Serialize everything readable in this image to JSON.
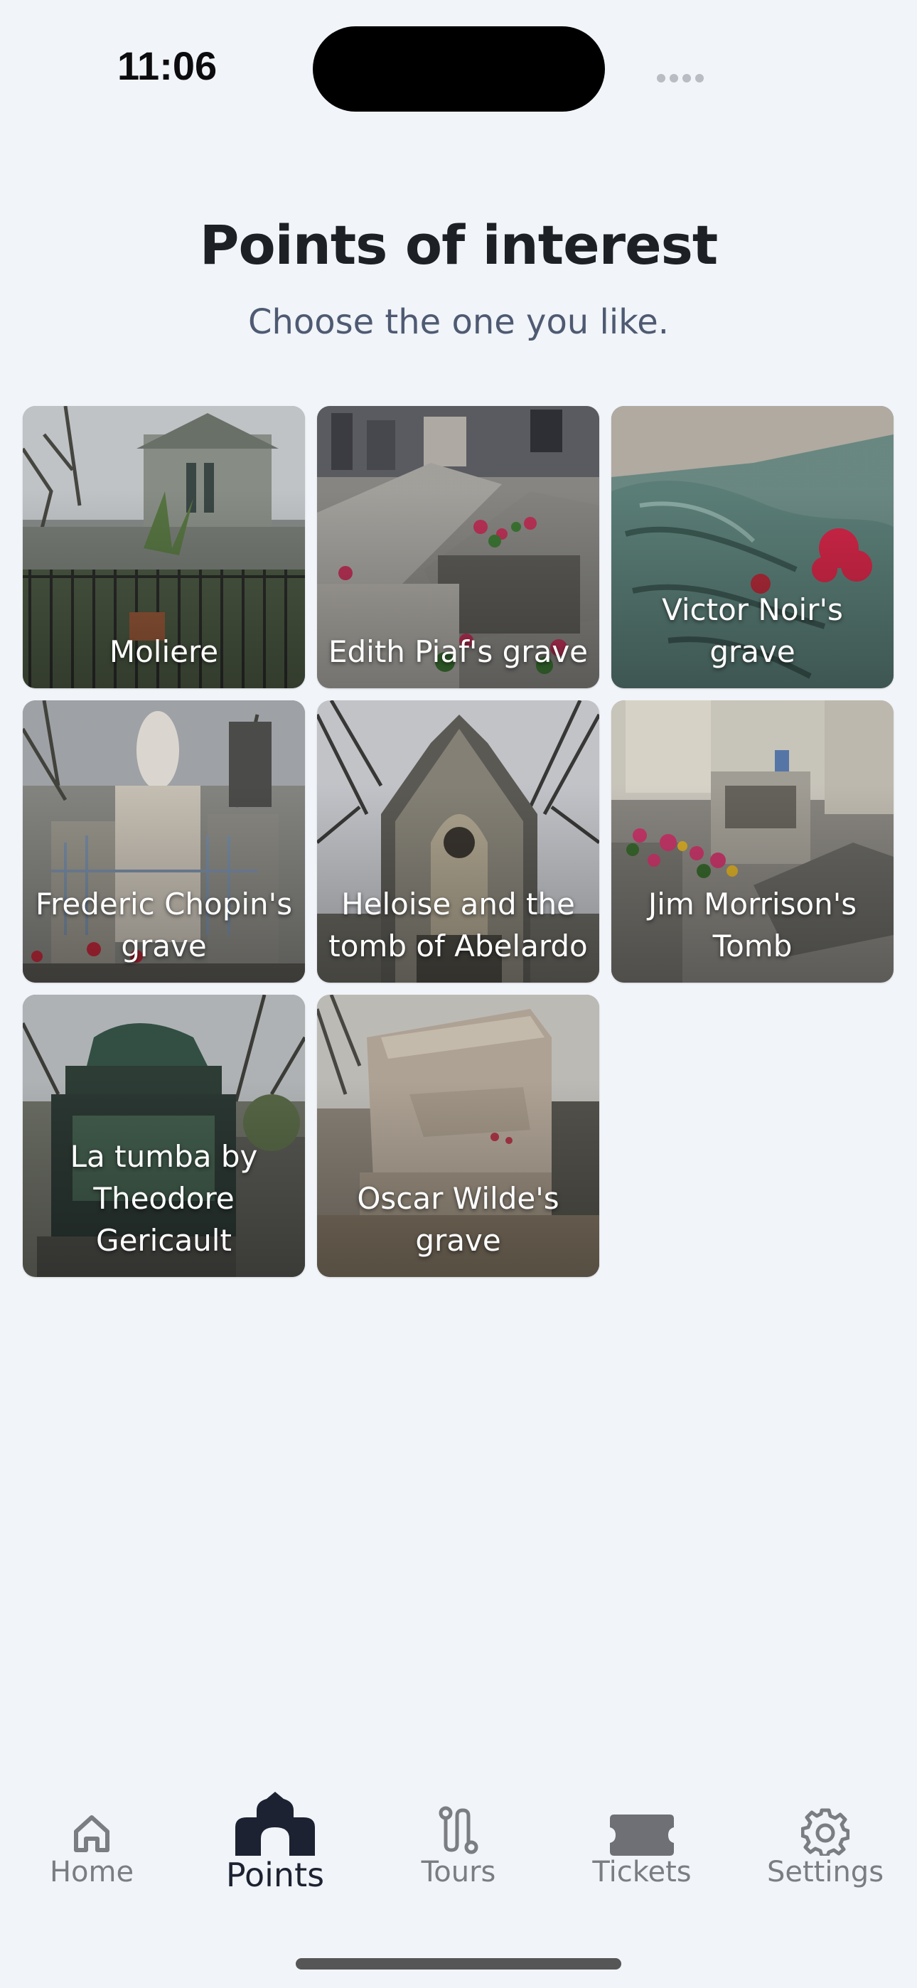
{
  "status_bar": {
    "time": "11:06"
  },
  "header": {
    "title": "Points of interest",
    "subtitle": "Choose the one you like."
  },
  "points": [
    {
      "label": "Moliere",
      "photo": "tomb-photo"
    },
    {
      "label": "Edith Piaf's grave",
      "photo": "tomb-photo"
    },
    {
      "label": "Victor Noir's grave",
      "photo": "statue-photo"
    },
    {
      "label": "Frederic Chopin's grave",
      "photo": "statue-photo"
    },
    {
      "label": "Heloise and the tomb of Abelardo",
      "photo": "chapel-photo"
    },
    {
      "label": "Jim Morrison's Tomb",
      "photo": "tomb-photo"
    },
    {
      "label": "La tumba by Theodore Gericault",
      "photo": "statue-photo"
    },
    {
      "label": "Oscar Wilde's grave",
      "photo": "monument-photo"
    }
  ],
  "tabbar": {
    "items": [
      {
        "label": "Home",
        "icon": "home-icon",
        "active": false
      },
      {
        "label": "Points",
        "icon": "chapel-icon",
        "active": true
      },
      {
        "label": "Tours",
        "icon": "route-icon",
        "active": false
      },
      {
        "label": "Tickets",
        "icon": "ticket-icon",
        "active": false
      },
      {
        "label": "Settings",
        "icon": "gear-icon",
        "active": false
      }
    ]
  },
  "colors": {
    "background": "#f1f4f8",
    "title": "#1d2025",
    "subtitle": "#4e5a72",
    "active_tab": "#1d2232",
    "inactive_tab": "#7a7d82"
  }
}
